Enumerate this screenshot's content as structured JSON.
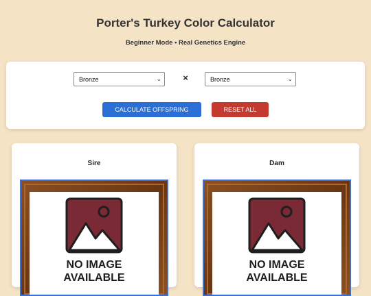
{
  "header": {
    "title": "Porter's Turkey Color Calculator",
    "subtitle": "Beginner Mode • Real Genetics Engine"
  },
  "controls": {
    "sire_select": "Bronze",
    "dam_select": "Bronze",
    "cross_symbol": "×",
    "calculate_label": "CALCULATE OFFSPRING",
    "reset_label": "RESET ALL"
  },
  "cards": {
    "sire": {
      "label": "Sire",
      "placeholder_line1": "NO IMAGE",
      "placeholder_line2": "AVAILABLE"
    },
    "dam": {
      "label": "Dam",
      "placeholder_line1": "NO IMAGE",
      "placeholder_line2": "AVAILABLE"
    }
  },
  "colors": {
    "background": "#f5e3c6",
    "calculate_button": "#2b6fd6",
    "reset_button": "#c53a2e",
    "frame_wood": "#7a4418",
    "placeholder_fill": "#7a2a35"
  },
  "icons": {
    "select_arrow": "chevron-down-icon",
    "placeholder": "image-placeholder-icon"
  }
}
